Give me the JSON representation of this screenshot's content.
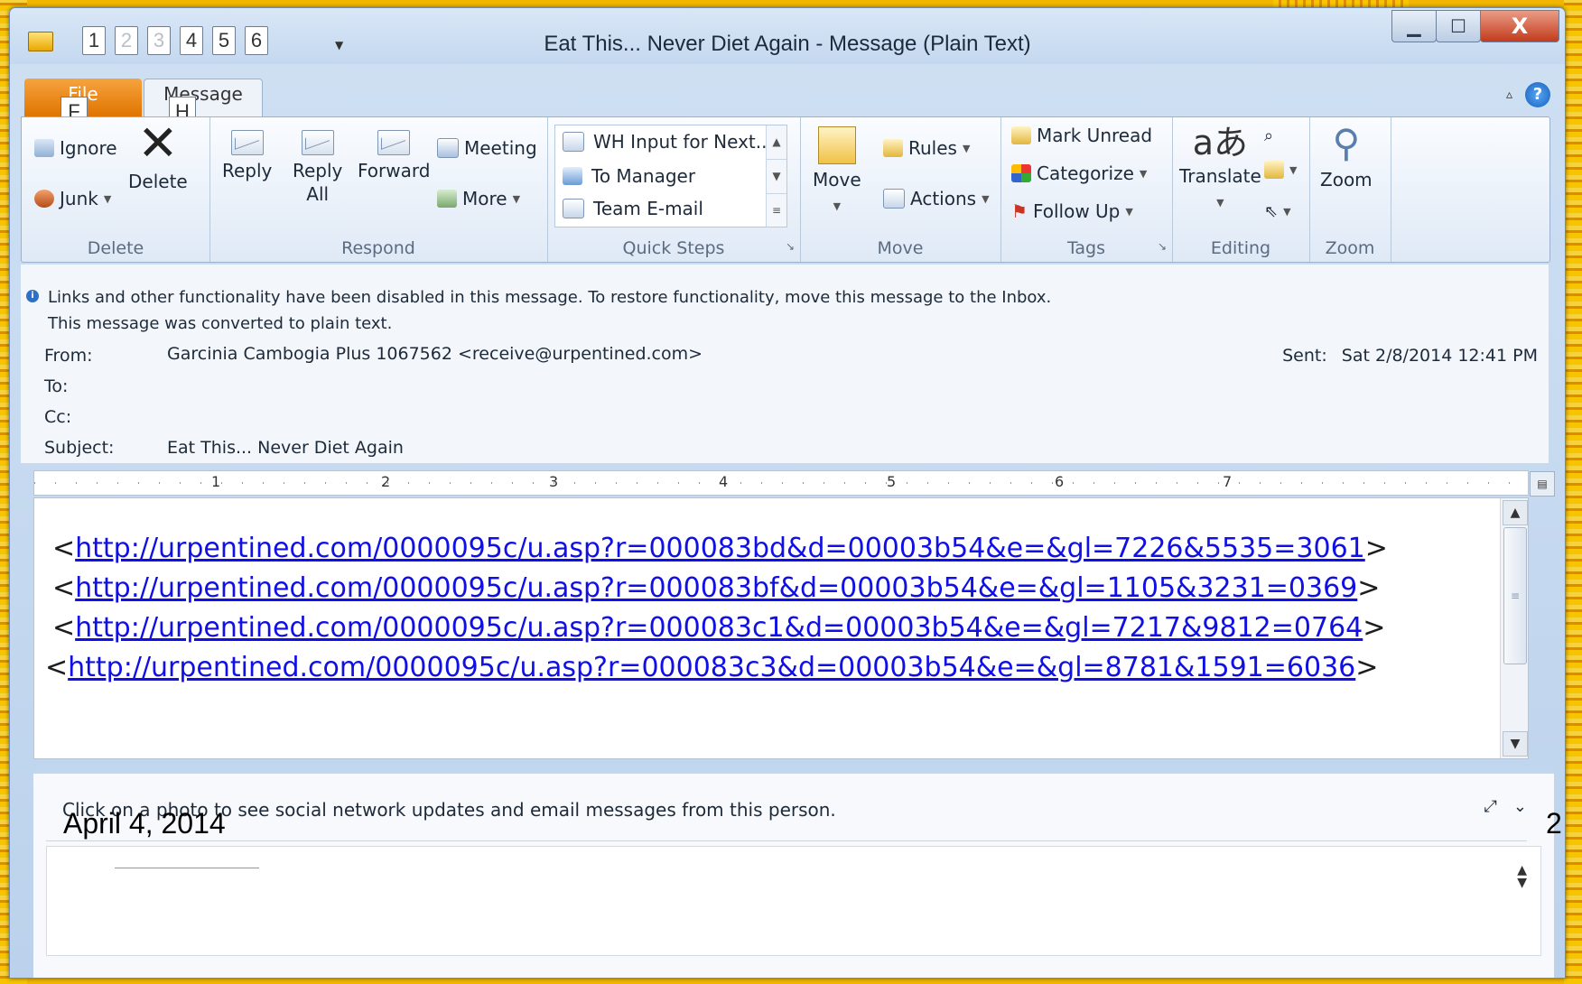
{
  "window": {
    "title": "Eat This... Never Diet Again  -  Message (Plain Text)",
    "qat_keys": [
      "1",
      "2",
      "3",
      "4",
      "5",
      "6"
    ],
    "min_glyph": "▁",
    "max_glyph": "☐",
    "close_glyph": "X"
  },
  "tabs": {
    "file": "File",
    "message": "Message",
    "file_keytip": "F",
    "message_keytip": "H"
  },
  "ribbon": {
    "delete": {
      "ignore": "Ignore",
      "junk": "Junk",
      "delete": "Delete",
      "label": "Delete"
    },
    "respond": {
      "reply": "Reply",
      "reply_all_1": "Reply",
      "reply_all_2": "All",
      "forward": "Forward",
      "meeting": "Meeting",
      "more": "More",
      "label": "Respond"
    },
    "quick_steps": {
      "items": [
        "WH Input for Next...",
        "To Manager",
        "Team E-mail"
      ],
      "label": "Quick Steps"
    },
    "move": {
      "move": "Move",
      "rules": "Rules",
      "actions": "Actions",
      "label": "Move"
    },
    "tags": {
      "mark_unread": "Mark Unread",
      "categorize": "Categorize",
      "follow_up": "Follow Up",
      "label": "Tags"
    },
    "editing": {
      "translate": "Translate",
      "label": "Editing"
    },
    "zoom": {
      "zoom": "Zoom",
      "label": "Zoom"
    }
  },
  "info_bar": {
    "line1": "Links and other functionality have been disabled in this message. To restore functionality, move this message to the Inbox.",
    "line2": "This message was converted to plain text."
  },
  "headers": {
    "from_label": "From:",
    "from_value": "Garcinia Cambogia Plus 1067562 <receive@urpentined.com>",
    "to_label": "To:",
    "cc_label": "Cc:",
    "subject_label": "Subject:",
    "subject_value": "Eat This... Never Diet Again",
    "sent_label": "Sent:",
    "sent_value": "Sat 2/8/2014 12:41 PM"
  },
  "ruler": {
    "marks": [
      "1",
      "2",
      "3",
      "4",
      "5",
      "6",
      "7"
    ]
  },
  "body": {
    "links": [
      "http://urpentined.com/0000095c/u.asp?r=000083bd&d=00003b54&e=&gl=7226&5535=3061",
      "http://urpentined.com/0000095c/u.asp?r=000083bf&d=00003b54&e=&gl=1105&3231=0369",
      "http://urpentined.com/0000095c/u.asp?r=000083c1&d=00003b54&e=&gl=7217&9812=0764",
      "http://urpentined.com/0000095c/u.asp?r=000083c3&d=00003b54&e=&gl=8781&1591=6036"
    ]
  },
  "people_pane": {
    "text": "Click on a photo to see social network updates and email messages from this person."
  },
  "slide": {
    "date": "April 4, 2014",
    "page_number": "2"
  }
}
